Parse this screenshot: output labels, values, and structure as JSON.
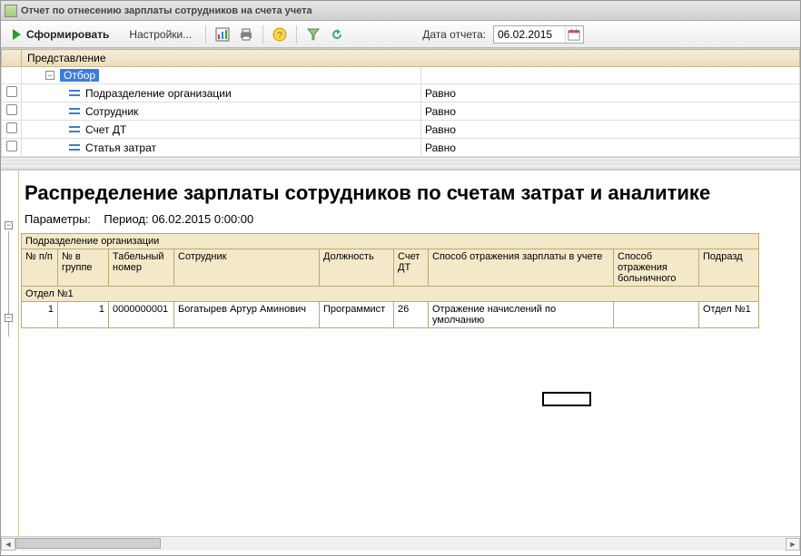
{
  "window": {
    "title": "Отчет по отнесению зарплаты сотрудников на счета учета"
  },
  "toolbar": {
    "form_label": "Сформировать",
    "settings_label": "Настройки...",
    "date_label": "Дата отчета:",
    "date_value": "06.02.2015"
  },
  "filter": {
    "header": "Представление",
    "root": "Отбор",
    "rows": [
      {
        "label": "Подразделение организации",
        "cond": "Равно"
      },
      {
        "label": "Сотрудник",
        "cond": "Равно"
      },
      {
        "label": "Счет ДТ",
        "cond": "Равно"
      },
      {
        "label": "Статья затрат",
        "cond": "Равно"
      }
    ]
  },
  "report": {
    "title": "Распределение зарплаты сотрудников по счетам затрат и аналитике",
    "params_label": "Параметры:",
    "params_value": "Период: 06.02.2015 0:00:00",
    "group_header": "Подразделение организации",
    "columns": {
      "npp": "№ п/п",
      "ngroup": "№ в группе",
      "tabnum": "Табельный номер",
      "employee": "Сотрудник",
      "position": "Должность",
      "account": "Счет ДТ",
      "reflect": "Способ отражения зарплаты в учете",
      "sick": "Способ отражения больничного",
      "division": "Подразд"
    },
    "group_row": "Отдел №1",
    "data_rows": [
      {
        "npp": "1",
        "ngroup": "1",
        "tabnum": "0000000001",
        "employee": "Богатырев Артур Аминович",
        "position": "Программист",
        "account": "26",
        "reflect": "Отражение начислений по умолчанию",
        "sick": "",
        "division": "Отдел №1"
      }
    ]
  }
}
